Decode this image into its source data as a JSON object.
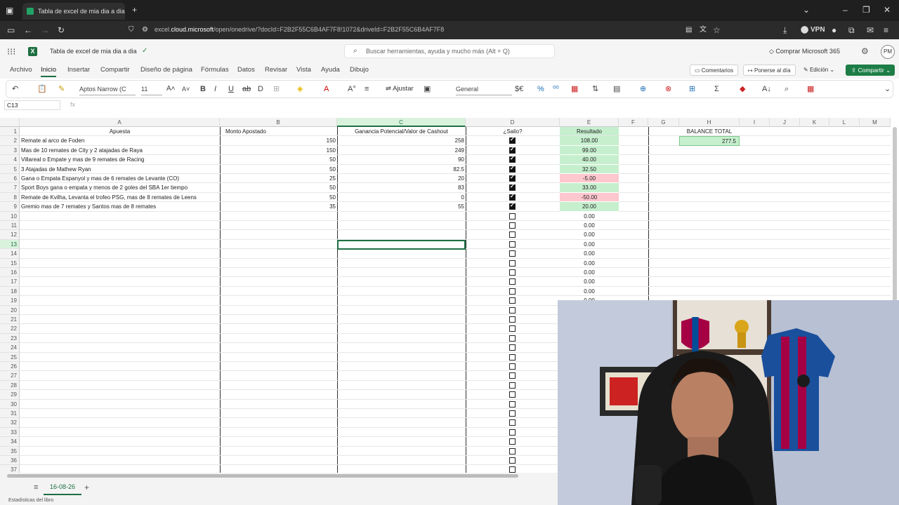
{
  "browser": {
    "tab_title": "Tabla de excel de mia dia a dia.",
    "url_prefix": "excel.",
    "url_host": "cloud.microsoft",
    "url_path": "/open/onedrive/?docId=F2B2F55C6B4AF7F8!1072&driveId=F2B2F55C6B4AF7F8",
    "vpn_label": "VPN"
  },
  "app": {
    "doc_title": "Tabla de excel de mia dia a dia",
    "search_placeholder": "Buscar herramientas, ayuda y mucho más (Alt + Q)",
    "buy_label": "Comprar Microsoft 365",
    "avatar_initials": "PM"
  },
  "menu": {
    "items": [
      "Archivo",
      "Inicio",
      "Insertar",
      "Compartir",
      "Diseño de página",
      "Fórmulas",
      "Datos",
      "Revisar",
      "Vista",
      "Ayuda",
      "Dibujo"
    ],
    "comments": "Comentarios",
    "catchup": "Ponerse al día",
    "editing": "Edición",
    "share": "Compartir"
  },
  "ribbon": {
    "font": "Aptos Narrow (C",
    "size": "11",
    "wrap": "Ajustar",
    "number_format": "General"
  },
  "formula": {
    "namebox": "C13",
    "fx": "fx"
  },
  "columns": [
    "A",
    "B",
    "C",
    "D",
    "E",
    "F",
    "G",
    "H",
    "I",
    "J",
    "K",
    "L",
    "M"
  ],
  "headers": {
    "a": "Apuesta",
    "b": "Monto Apostado",
    "c": "Ganancia Potencial/Valor de Cashout",
    "d": "¿Salio?",
    "e": "Resultado",
    "h": "BALANCE TOTAL"
  },
  "balance_total": "277.5",
  "rows": [
    {
      "a": "Remate al arco de Foden",
      "b": "150",
      "c": "258",
      "d": true,
      "e": "108.00",
      "status": "win"
    },
    {
      "a": "Mas de 10 remates de City y 2 atajadas de Raya",
      "b": "150",
      "c": "249",
      "d": true,
      "e": "99.00",
      "status": "win"
    },
    {
      "a": "Villareal o Empate y mas de 9 remates de Racing",
      "b": "50",
      "c": "90",
      "d": true,
      "e": "40.00",
      "status": "win"
    },
    {
      "a": "3 Atajadas de Mathew Ryan",
      "b": "50",
      "c": "82.5",
      "d": true,
      "e": "32.50",
      "status": "win"
    },
    {
      "a": "Gana o Empata Espanyol y mas de 6 remates de Levante (CO)",
      "b": "25",
      "c": "20",
      "d": true,
      "e": "-5.00",
      "status": "loss"
    },
    {
      "a": "Sport Boys gana o empata y menos de 2 goles del SBA 1er tiempo",
      "b": "50",
      "c": "83",
      "d": true,
      "e": "33.00",
      "status": "win"
    },
    {
      "a": "Remate de Kvilha, Levanta el trofeo PSG, mas de 8 remates de Leens",
      "b": "50",
      "c": "0",
      "d": true,
      "e": "-50.00",
      "status": "loss"
    },
    {
      "a": "Gremio mas de 7 remates y Santos mas de 8 remates",
      "b": "35",
      "c": "55",
      "d": true,
      "e": "20.00",
      "status": "win"
    }
  ],
  "empty_result": "0.00",
  "sheet_tab": "16-08-26",
  "status_bar": "Estadísticas del libro",
  "colors": {
    "win": "#c6efce",
    "loss": "#ffc7ce",
    "accent": "#1d6f42"
  }
}
